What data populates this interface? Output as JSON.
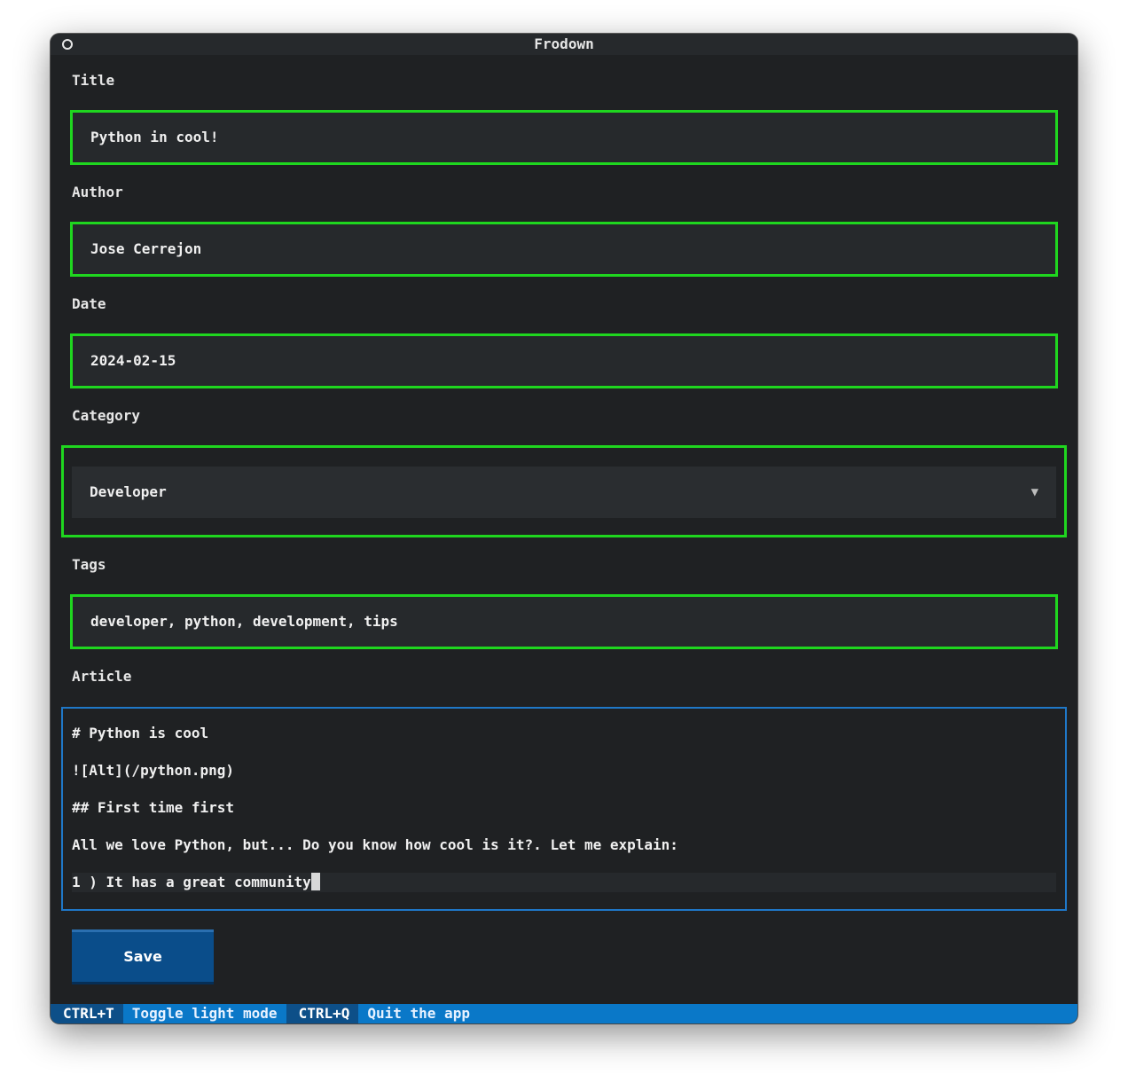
{
  "window": {
    "title": "Frodown"
  },
  "form": {
    "title_label": "Title",
    "title_value": "Python in cool!",
    "author_label": "Author",
    "author_value": "Jose Cerrejon",
    "date_label": "Date",
    "date_value": "2024-02-15",
    "category_label": "Category",
    "category_value": "Developer",
    "category_arrow": "▼",
    "tags_label": "Tags",
    "tags_value": "developer, python, development, tips",
    "article_label": "Article",
    "article_lines": [
      "# Python is cool",
      "![Alt](/python.png)",
      "## First time first",
      "All we love Python, but... Do you know how cool is it?. Let me explain:",
      "1 ) It has a great community"
    ],
    "save_label": "Save"
  },
  "footer": {
    "bindings": [
      {
        "key": "CTRL+T",
        "description": "Toggle light mode"
      },
      {
        "key": "CTRL+Q",
        "description": "Quit the app"
      }
    ]
  },
  "colors": {
    "background": "#1f2123",
    "field_border": "#1fd61f",
    "focus_border": "#1f78c8",
    "footer": "#0a78c8",
    "button": "#0a4d8a"
  }
}
